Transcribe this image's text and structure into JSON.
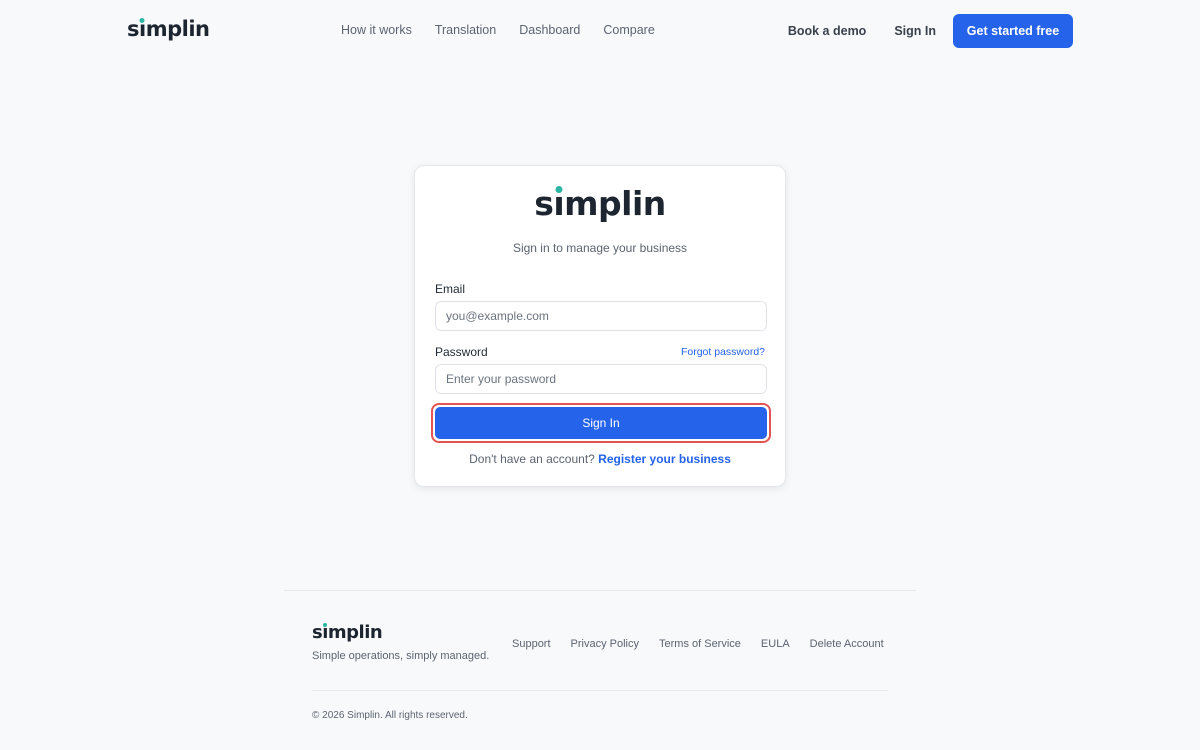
{
  "brand": {
    "name_prefix": "s",
    "name_i": "ı",
    "name_suffix": "mplin",
    "accent_color": "#2bb5a5",
    "primary_color": "#2563eb"
  },
  "header": {
    "nav": [
      "How it works",
      "Translation",
      "Dashboard",
      "Compare"
    ],
    "book_demo": "Book a demo",
    "sign_in": "Sign In",
    "cta": "Get started free"
  },
  "card": {
    "subtitle": "Sign in to manage your business",
    "email_label": "Email",
    "email_placeholder": "you@example.com",
    "password_label": "Password",
    "forgot_password": "Forgot password?",
    "password_placeholder": "Enter your password",
    "sign_in_button": "Sign In",
    "no_account_text": "Don't have an account?",
    "register_link": "Register your business"
  },
  "footer": {
    "tagline": "Simple operations, simply managed.",
    "links": [
      "Support",
      "Privacy Policy",
      "Terms of Service",
      "EULA",
      "Delete Account"
    ],
    "copyright": "© 2026 Simplin. All rights reserved."
  }
}
